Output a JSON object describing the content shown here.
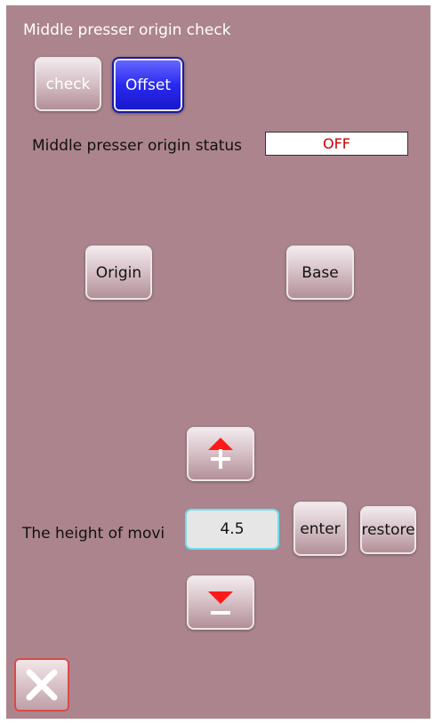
{
  "title": "Middle presser origin check",
  "mode_buttons": {
    "check": "check",
    "offset": "Offset"
  },
  "status": {
    "label": "Middle presser origin status",
    "value": "OFF"
  },
  "actions": {
    "origin": "Origin",
    "base": "Base"
  },
  "height": {
    "label": "The height of movi",
    "value": "4.5",
    "enter": "enter",
    "restore": "restore"
  },
  "icons": {
    "increase": "plus-up-arrow-icon",
    "decrease": "minus-down-arrow-icon",
    "close": "close-x-icon"
  },
  "colors": {
    "background": "#ac848d",
    "active_button": "#2a2af0",
    "status_value": "#cc0000",
    "input_border": "#6ee0ea",
    "close_border": "#d94a4a"
  }
}
